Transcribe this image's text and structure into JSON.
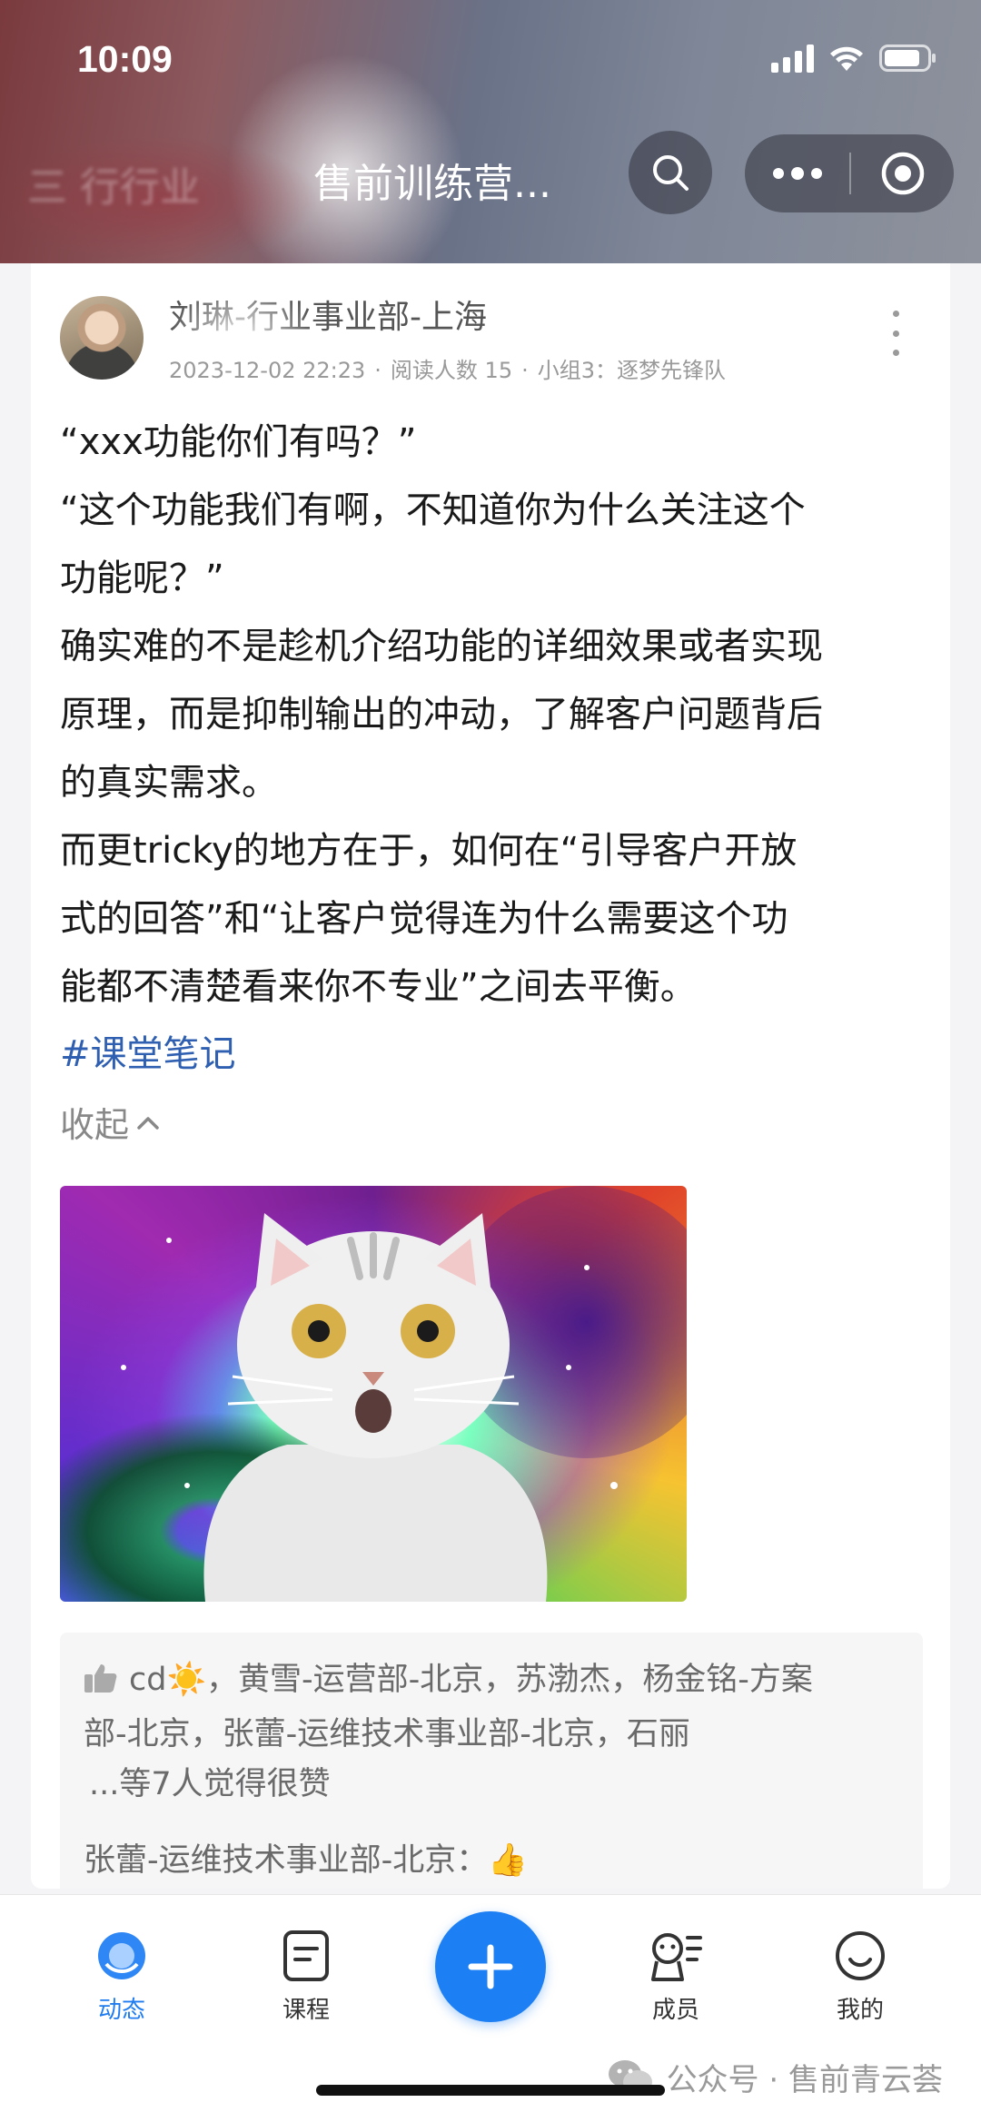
{
  "status_bar": {
    "time": "10:09"
  },
  "nav": {
    "back_text": "三 行行业",
    "title": "售前训练营..."
  },
  "post": {
    "author": "刘琳-行业事业部-上海",
    "date": "2023-12-02 22:23",
    "reads": "阅读人数 15",
    "group": "小组3：逐梦先锋队",
    "lines": [
      "“xxx功能你们有吗？”",
      "“这个功能我们有啊，不知道你为什么关注这个",
      "功能呢？”",
      "确实难的不是趁机介绍功能的详细效果或者实现",
      "原理，而是抑制输出的冲动，了解客户问题背后",
      "的真实需求。",
      "而更tricky的地方在于，如何在“引导客户开放",
      "式的回答”和“让客户觉得连为什么需要这个功",
      "能都不清楚看来你不专业”之间去平衡。"
    ],
    "hashtag": "#课堂笔记",
    "collapse_label": "收起"
  },
  "likes": {
    "line1": "cd☀️，黄雪-运营部-北京，苏渤杰，杨金铭-方案",
    "line2": "部-北京，张蕾-运维技术事业部-北京，石丽",
    "more": "...等7人觉得很赞",
    "comment": "张蕾-运维技术事业部-北京：👍"
  },
  "tabbar": {
    "tabs": [
      {
        "label": "动态",
        "icon": "feed-icon",
        "active": true
      },
      {
        "label": "课程",
        "icon": "course-icon",
        "active": false
      },
      {
        "label": "成员",
        "icon": "members-icon",
        "active": false
      },
      {
        "label": "我的",
        "icon": "profile-icon",
        "active": false
      }
    ],
    "add_icon": "plus-icon"
  },
  "watermark": "公众号 · 售前青云荟",
  "colors": {
    "accent": "#1c7ff3",
    "hashtag": "#2f5fb0",
    "text": "#1a1a1a",
    "muted": "#999999"
  }
}
